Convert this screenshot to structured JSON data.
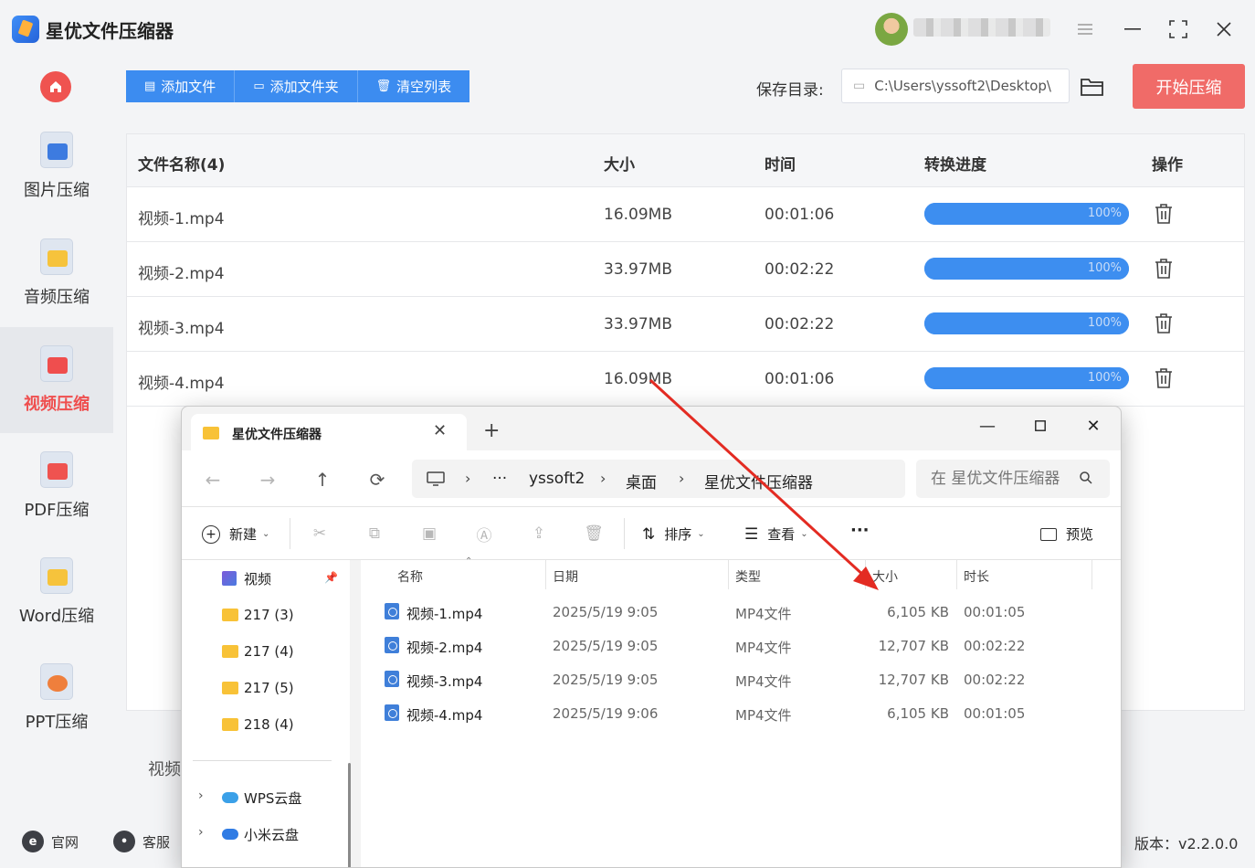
{
  "app": {
    "title": "星优文件压缩器",
    "version": "版本：v2.2.0.0"
  },
  "sidebar": {
    "items": [
      {
        "label": "图片压缩",
        "icon": "image-compress-icon",
        "color": "#3d7be0"
      },
      {
        "label": "音频压缩",
        "icon": "audio-compress-icon",
        "color": "#f6c33c"
      },
      {
        "label": "视频压缩",
        "icon": "video-compress-icon",
        "color": "#ef4e4e"
      },
      {
        "label": "PDF压缩",
        "icon": "pdf-compress-icon",
        "color": "#ef5350"
      },
      {
        "label": "Word压缩",
        "icon": "word-compress-icon",
        "color": "#f6c33c"
      },
      {
        "label": "PPT压缩",
        "icon": "ppt-compress-icon",
        "color": "#ef7f3c"
      }
    ],
    "active_index": 2,
    "footer": {
      "website": "官网",
      "support": "客服"
    }
  },
  "toolbar": {
    "add_file": "添加文件",
    "add_folder": "添加文件夹",
    "clear_list": "清空列表",
    "save_dir_label": "保存目录:",
    "save_dir_value": "C:\\Users\\yssoft2\\Desktop\\",
    "start": "开始压缩"
  },
  "table": {
    "headers": {
      "name": "文件名称(4)",
      "size": "大小",
      "time": "时间",
      "progress": "转换进度",
      "action": "操作"
    },
    "rows": [
      {
        "name": "视频-1.mp4",
        "size": "16.09MB",
        "time": "00:01:06",
        "progress": 100,
        "progress_label": "100%"
      },
      {
        "name": "视频-2.mp4",
        "size": "33.97MB",
        "time": "00:02:22",
        "progress": 100,
        "progress_label": "100%"
      },
      {
        "name": "视频-3.mp4",
        "size": "33.97MB",
        "time": "00:02:22",
        "progress": 100,
        "progress_label": "100%"
      },
      {
        "name": "视频-4.mp4",
        "size": "16.09MB",
        "time": "00:01:06",
        "progress": 100,
        "progress_label": "100%"
      }
    ]
  },
  "bottom_label": "视频",
  "explorer": {
    "tab_title": "星优文件压缩器",
    "breadcrumb": [
      "yssoft2",
      "桌面",
      "星优文件压缩器"
    ],
    "search_placeholder": "在 星优文件压缩器",
    "commands": {
      "new": "新建",
      "sort": "排序",
      "view": "查看",
      "more": "···",
      "preview": "预览"
    },
    "sidebar": [
      {
        "label": "视频",
        "type": "video"
      },
      {
        "label": "217 (3)",
        "type": "folder"
      },
      {
        "label": "217 (4)",
        "type": "folder"
      },
      {
        "label": "217 (5)",
        "type": "folder"
      },
      {
        "label": "218 (4)",
        "type": "folder"
      }
    ],
    "cloud": [
      {
        "label": "WPS云盘"
      },
      {
        "label": "小米云盘"
      }
    ],
    "columns": {
      "name": "名称",
      "date": "日期",
      "type": "类型",
      "size": "大小",
      "duration": "时长"
    },
    "files": [
      {
        "name": "视频-1.mp4",
        "date": "2025/5/19 9:05",
        "type": "MP4文件",
        "size": "6,105 KB",
        "duration": "00:01:05"
      },
      {
        "name": "视频-2.mp4",
        "date": "2025/5/19 9:05",
        "type": "MP4文件",
        "size": "12,707 KB",
        "duration": "00:02:22"
      },
      {
        "name": "视频-3.mp4",
        "date": "2025/5/19 9:05",
        "type": "MP4文件",
        "size": "12,707 KB",
        "duration": "00:02:22"
      },
      {
        "name": "视频-4.mp4",
        "date": "2025/5/19 9:06",
        "type": "MP4文件",
        "size": "6,105 KB",
        "duration": "00:01:05"
      }
    ]
  },
  "colors": {
    "accent": "#3c8cf0",
    "start": "#f06b68",
    "active": "#ef4e4e"
  }
}
